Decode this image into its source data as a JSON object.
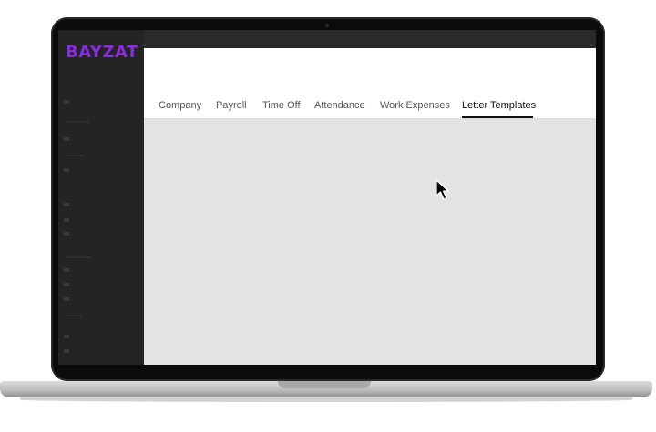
{
  "app": {
    "logo_text": "BAYZAT",
    "brand_color": "#8a2be2"
  },
  "tabs": [
    {
      "label": "Company",
      "active": false
    },
    {
      "label": "Payroll",
      "active": false
    },
    {
      "label": "Time Off",
      "active": false
    },
    {
      "label": "Attendance",
      "active": false
    },
    {
      "label": "Work Expenses",
      "active": false
    },
    {
      "label": "Letter Templates",
      "active": true
    }
  ],
  "icons": {
    "cursor": "arrow-cursor-icon",
    "camera": "camera-icon"
  }
}
